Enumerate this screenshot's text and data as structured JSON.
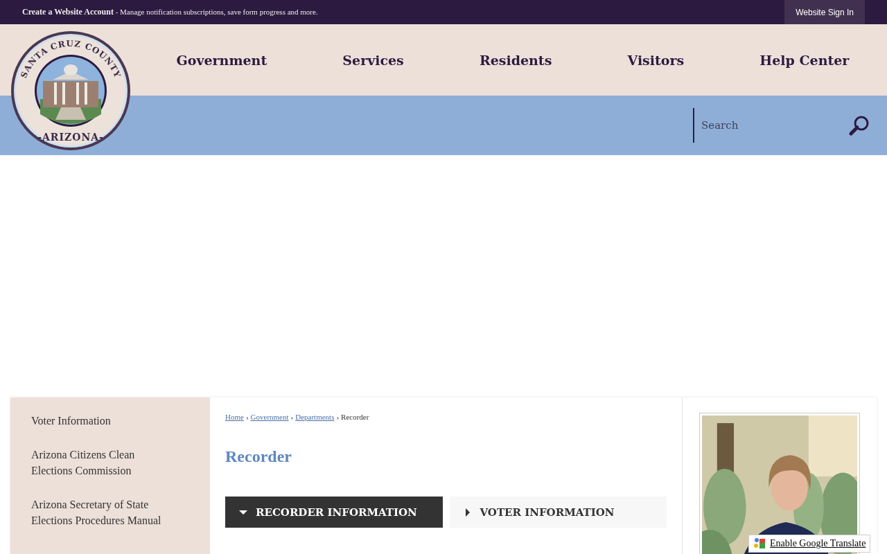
{
  "top_bar": {
    "account_link": "Create a Website Account",
    "account_note": "- Manage notification subscriptions, save form progress and more.",
    "sign_in": "Website Sign In"
  },
  "logo": {
    "arc_text": "SANTA CRUZ COUNTY",
    "bottom_text": "-ARIZONA-"
  },
  "nav": [
    "Government",
    "Services",
    "Residents",
    "Visitors",
    "Help Center"
  ],
  "search": {
    "placeholder": "Search"
  },
  "sidebar": {
    "items": [
      "Voter Information",
      "Arizona Citizens Clean Elections Commission",
      "Arizona Secretary of State Elections Procedures Manual"
    ]
  },
  "breadcrumb": {
    "links": [
      "Home",
      "Government",
      "Departments"
    ],
    "separator": "›",
    "current": "Recorder"
  },
  "page_title": "Recorder",
  "tabs": [
    {
      "label": "RECORDER INFORMATION",
      "selected": true
    },
    {
      "label": "VOTER INFORMATION",
      "selected": false
    }
  ],
  "translate": {
    "label": "Enable Google Translate"
  }
}
